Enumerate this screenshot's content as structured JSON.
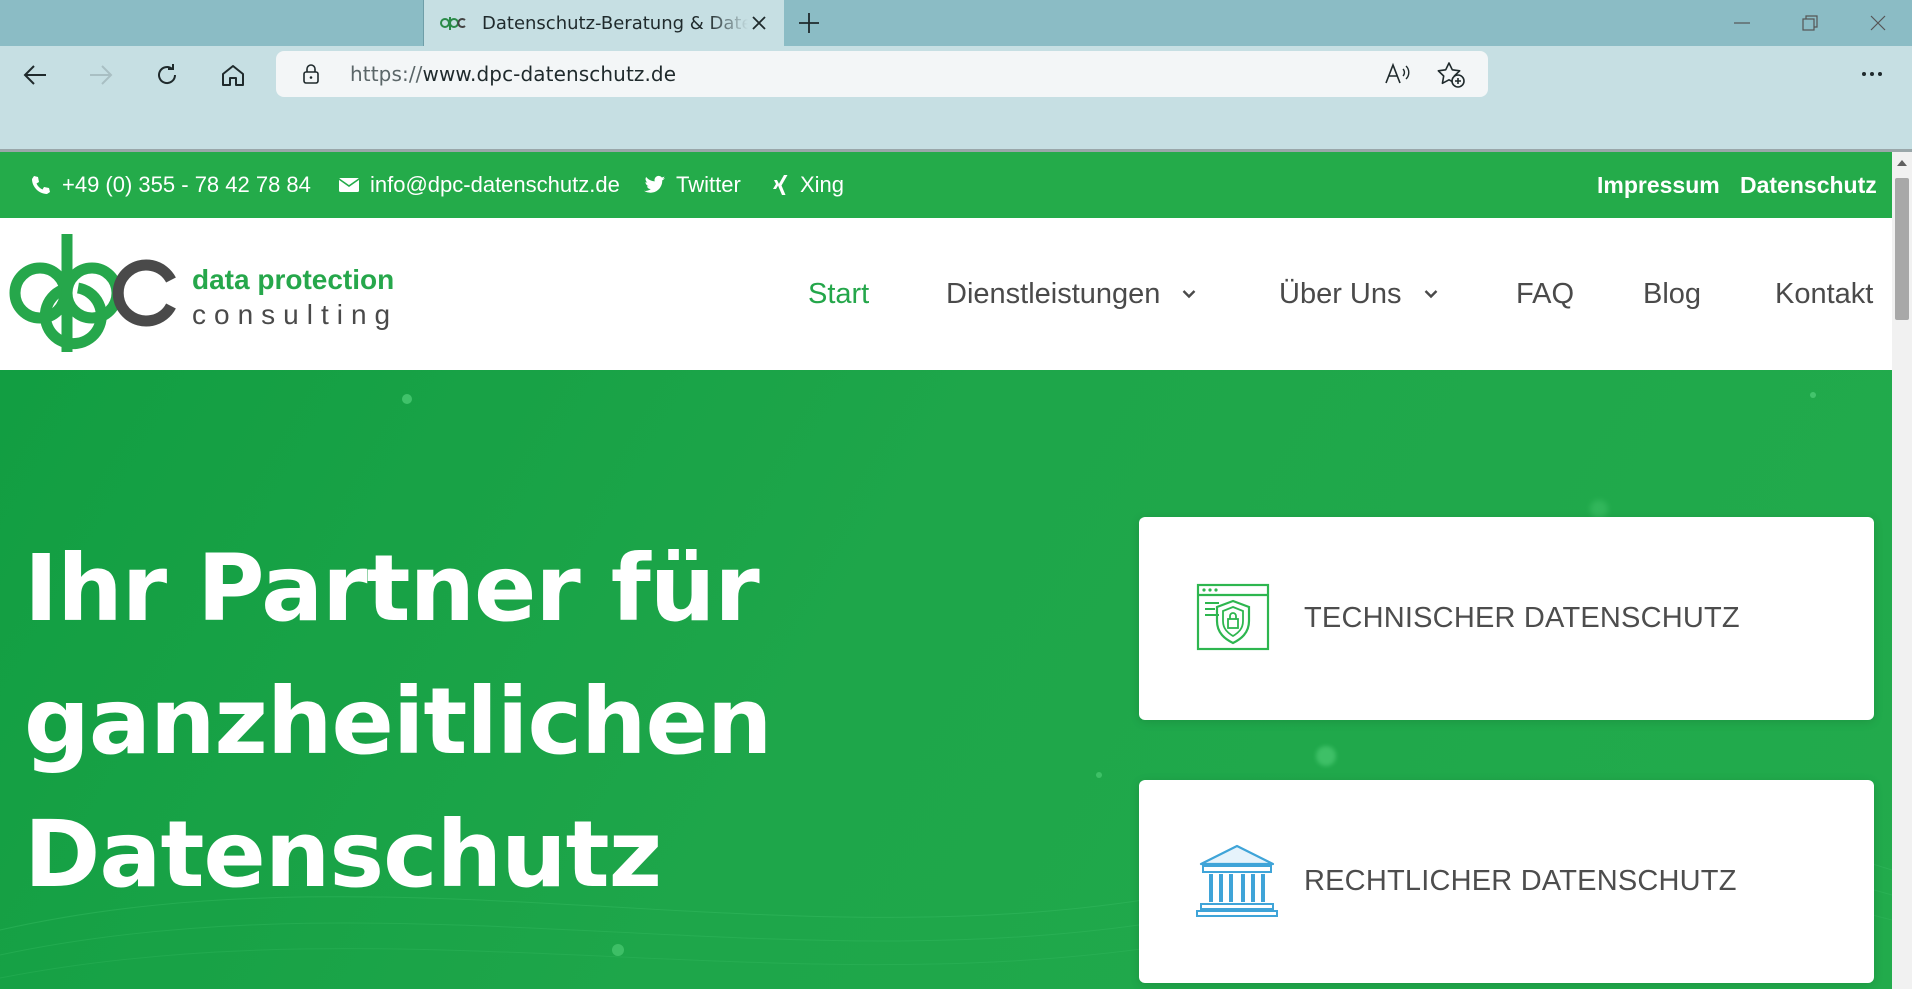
{
  "browser": {
    "tab_title": "Datenschutz-Beratung & Datenschutz",
    "url_scheme": "https://",
    "url_host": "www.dpc-datenschutz.de",
    "new_tab_label": "+"
  },
  "topbar": {
    "phone": "+49 (0) 355 - 78 42 78 84",
    "email": "info@dpc-datenschutz.de",
    "twitter": "Twitter",
    "xing": "Xing",
    "impressum": "Impressum",
    "datenschutz": "Datenschutz"
  },
  "logo": {
    "mark": "dpc",
    "line1": "data protection",
    "line2": "consulting"
  },
  "nav": {
    "start": "Start",
    "dienstleistungen": "Dienstleistungen",
    "ueber_uns": "Über Uns",
    "faq": "FAQ",
    "blog": "Blog",
    "kontakt": "Kontakt"
  },
  "hero": {
    "line1": "Ihr Partner für",
    "line2": "ganzheitlichen",
    "line3": "Datenschutz"
  },
  "cards": [
    {
      "label": "TECHNISCHER DATENSCHUTZ",
      "icon": "shield-browser-icon"
    },
    {
      "label": "RECHTLICHER DATENSCHUTZ",
      "icon": "courthouse-icon"
    }
  ],
  "colors": {
    "brand_green": "#24ab4a",
    "chrome_bg": "#c6dfe3",
    "tabstrip_bg": "#8bbcc5"
  }
}
